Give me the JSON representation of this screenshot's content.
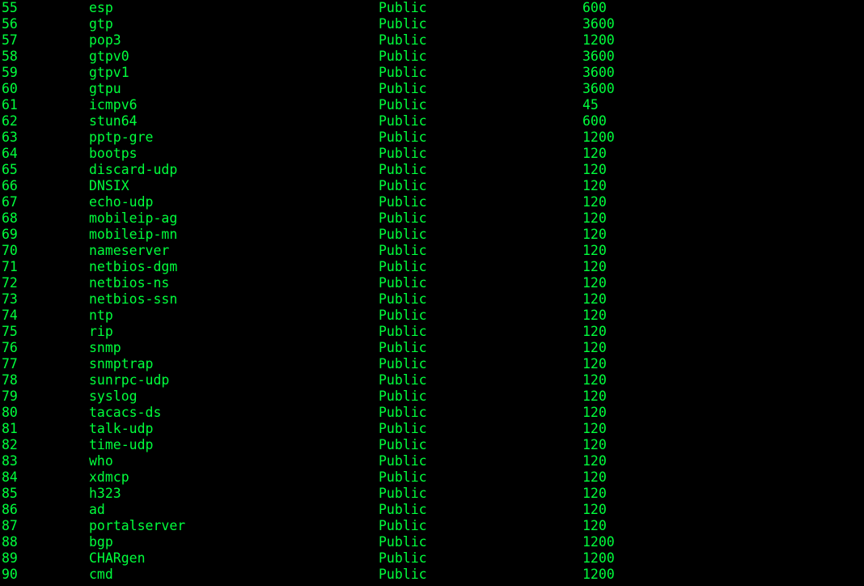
{
  "rows": [
    {
      "num": "55",
      "name": "esp",
      "scope": "Public",
      "value": "600"
    },
    {
      "num": "56",
      "name": "gtp",
      "scope": "Public",
      "value": "3600"
    },
    {
      "num": "57",
      "name": "pop3",
      "scope": "Public",
      "value": "1200"
    },
    {
      "num": "58",
      "name": "gtpv0",
      "scope": "Public",
      "value": "3600"
    },
    {
      "num": "59",
      "name": "gtpv1",
      "scope": "Public",
      "value": "3600"
    },
    {
      "num": "60",
      "name": "gtpu",
      "scope": "Public",
      "value": "3600"
    },
    {
      "num": "61",
      "name": "icmpv6",
      "scope": "Public",
      "value": "45"
    },
    {
      "num": "62",
      "name": "stun64",
      "scope": "Public",
      "value": "600"
    },
    {
      "num": "63",
      "name": "pptp-gre",
      "scope": "Public",
      "value": "1200"
    },
    {
      "num": "64",
      "name": "bootps",
      "scope": "Public",
      "value": "120"
    },
    {
      "num": "65",
      "name": "discard-udp",
      "scope": "Public",
      "value": "120"
    },
    {
      "num": "66",
      "name": "DNSIX",
      "scope": "Public",
      "value": "120"
    },
    {
      "num": "67",
      "name": "echo-udp",
      "scope": "Public",
      "value": "120"
    },
    {
      "num": "68",
      "name": "mobileip-ag",
      "scope": "Public",
      "value": "120"
    },
    {
      "num": "69",
      "name": "mobileip-mn",
      "scope": "Public",
      "value": "120"
    },
    {
      "num": "70",
      "name": "nameserver",
      "scope": "Public",
      "value": "120"
    },
    {
      "num": "71",
      "name": "netbios-dgm",
      "scope": "Public",
      "value": "120"
    },
    {
      "num": "72",
      "name": "netbios-ns",
      "scope": "Public",
      "value": "120"
    },
    {
      "num": "73",
      "name": "netbios-ssn",
      "scope": "Public",
      "value": "120"
    },
    {
      "num": "74",
      "name": "ntp",
      "scope": "Public",
      "value": "120"
    },
    {
      "num": "75",
      "name": "rip",
      "scope": "Public",
      "value": "120"
    },
    {
      "num": "76",
      "name": "snmp",
      "scope": "Public",
      "value": "120"
    },
    {
      "num": "77",
      "name": "snmptrap",
      "scope": "Public",
      "value": "120"
    },
    {
      "num": "78",
      "name": "sunrpc-udp",
      "scope": "Public",
      "value": "120"
    },
    {
      "num": "79",
      "name": "syslog",
      "scope": "Public",
      "value": "120"
    },
    {
      "num": "80",
      "name": "tacacs-ds",
      "scope": "Public",
      "value": "120"
    },
    {
      "num": "81",
      "name": "talk-udp",
      "scope": "Public",
      "value": "120"
    },
    {
      "num": "82",
      "name": "time-udp",
      "scope": "Public",
      "value": "120"
    },
    {
      "num": "83",
      "name": "who",
      "scope": "Public",
      "value": "120"
    },
    {
      "num": "84",
      "name": "xdmcp",
      "scope": "Public",
      "value": "120"
    },
    {
      "num": "85",
      "name": "h323",
      "scope": "Public",
      "value": "120"
    },
    {
      "num": "86",
      "name": "ad",
      "scope": "Public",
      "value": "120"
    },
    {
      "num": "87",
      "name": "portalserver",
      "scope": "Public",
      "value": "120"
    },
    {
      "num": "88",
      "name": "bgp",
      "scope": "Public",
      "value": "1200"
    },
    {
      "num": "89",
      "name": "CHARgen",
      "scope": "Public",
      "value": "1200"
    },
    {
      "num": "90",
      "name": "cmd",
      "scope": "Public",
      "value": "1200"
    }
  ]
}
